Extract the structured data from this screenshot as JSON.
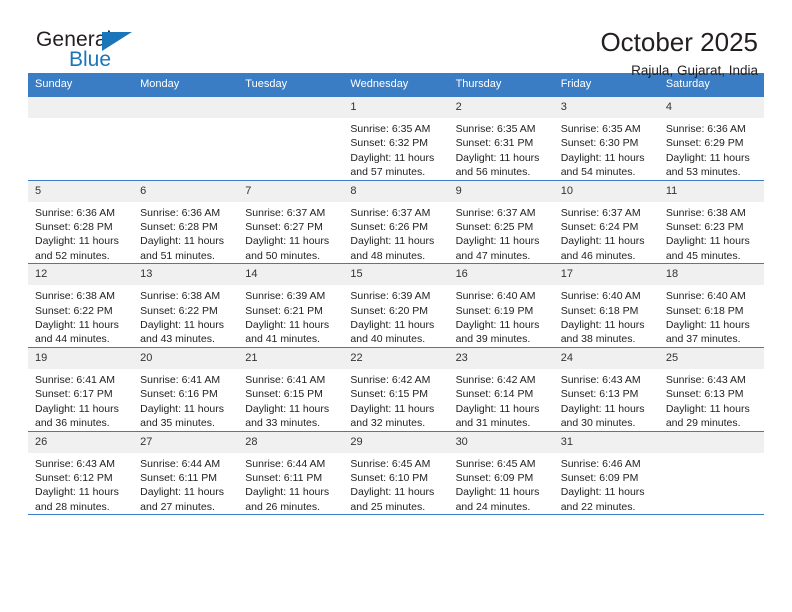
{
  "brand": {
    "word_general": "General",
    "word_blue": "Blue",
    "triangle_color": "#1b75bb"
  },
  "header": {
    "title": "October 2025",
    "location": "Rajula, Gujarat, India"
  },
  "theme": {
    "header_blue": "#3b7dc4",
    "daynum_bg": "#f0f0f0",
    "text": "#222222"
  },
  "calendar": {
    "day_headers": [
      "Sunday",
      "Monday",
      "Tuesday",
      "Wednesday",
      "Thursday",
      "Friday",
      "Saturday"
    ],
    "weeks": [
      [
        {
          "day": "",
          "sunrise": "",
          "sunset": "",
          "daylight": ""
        },
        {
          "day": "",
          "sunrise": "",
          "sunset": "",
          "daylight": ""
        },
        {
          "day": "",
          "sunrise": "",
          "sunset": "",
          "daylight": ""
        },
        {
          "day": "1",
          "sunrise": "Sunrise: 6:35 AM",
          "sunset": "Sunset: 6:32 PM",
          "daylight": "Daylight: 11 hours and 57 minutes."
        },
        {
          "day": "2",
          "sunrise": "Sunrise: 6:35 AM",
          "sunset": "Sunset: 6:31 PM",
          "daylight": "Daylight: 11 hours and 56 minutes."
        },
        {
          "day": "3",
          "sunrise": "Sunrise: 6:35 AM",
          "sunset": "Sunset: 6:30 PM",
          "daylight": "Daylight: 11 hours and 54 minutes."
        },
        {
          "day": "4",
          "sunrise": "Sunrise: 6:36 AM",
          "sunset": "Sunset: 6:29 PM",
          "daylight": "Daylight: 11 hours and 53 minutes."
        }
      ],
      [
        {
          "day": "5",
          "sunrise": "Sunrise: 6:36 AM",
          "sunset": "Sunset: 6:28 PM",
          "daylight": "Daylight: 11 hours and 52 minutes."
        },
        {
          "day": "6",
          "sunrise": "Sunrise: 6:36 AM",
          "sunset": "Sunset: 6:28 PM",
          "daylight": "Daylight: 11 hours and 51 minutes."
        },
        {
          "day": "7",
          "sunrise": "Sunrise: 6:37 AM",
          "sunset": "Sunset: 6:27 PM",
          "daylight": "Daylight: 11 hours and 50 minutes."
        },
        {
          "day": "8",
          "sunrise": "Sunrise: 6:37 AM",
          "sunset": "Sunset: 6:26 PM",
          "daylight": "Daylight: 11 hours and 48 minutes."
        },
        {
          "day": "9",
          "sunrise": "Sunrise: 6:37 AM",
          "sunset": "Sunset: 6:25 PM",
          "daylight": "Daylight: 11 hours and 47 minutes."
        },
        {
          "day": "10",
          "sunrise": "Sunrise: 6:37 AM",
          "sunset": "Sunset: 6:24 PM",
          "daylight": "Daylight: 11 hours and 46 minutes."
        },
        {
          "day": "11",
          "sunrise": "Sunrise: 6:38 AM",
          "sunset": "Sunset: 6:23 PM",
          "daylight": "Daylight: 11 hours and 45 minutes."
        }
      ],
      [
        {
          "day": "12",
          "sunrise": "Sunrise: 6:38 AM",
          "sunset": "Sunset: 6:22 PM",
          "daylight": "Daylight: 11 hours and 44 minutes."
        },
        {
          "day": "13",
          "sunrise": "Sunrise: 6:38 AM",
          "sunset": "Sunset: 6:22 PM",
          "daylight": "Daylight: 11 hours and 43 minutes."
        },
        {
          "day": "14",
          "sunrise": "Sunrise: 6:39 AM",
          "sunset": "Sunset: 6:21 PM",
          "daylight": "Daylight: 11 hours and 41 minutes."
        },
        {
          "day": "15",
          "sunrise": "Sunrise: 6:39 AM",
          "sunset": "Sunset: 6:20 PM",
          "daylight": "Daylight: 11 hours and 40 minutes."
        },
        {
          "day": "16",
          "sunrise": "Sunrise: 6:40 AM",
          "sunset": "Sunset: 6:19 PM",
          "daylight": "Daylight: 11 hours and 39 minutes."
        },
        {
          "day": "17",
          "sunrise": "Sunrise: 6:40 AM",
          "sunset": "Sunset: 6:18 PM",
          "daylight": "Daylight: 11 hours and 38 minutes."
        },
        {
          "day": "18",
          "sunrise": "Sunrise: 6:40 AM",
          "sunset": "Sunset: 6:18 PM",
          "daylight": "Daylight: 11 hours and 37 minutes."
        }
      ],
      [
        {
          "day": "19",
          "sunrise": "Sunrise: 6:41 AM",
          "sunset": "Sunset: 6:17 PM",
          "daylight": "Daylight: 11 hours and 36 minutes."
        },
        {
          "day": "20",
          "sunrise": "Sunrise: 6:41 AM",
          "sunset": "Sunset: 6:16 PM",
          "daylight": "Daylight: 11 hours and 35 minutes."
        },
        {
          "day": "21",
          "sunrise": "Sunrise: 6:41 AM",
          "sunset": "Sunset: 6:15 PM",
          "daylight": "Daylight: 11 hours and 33 minutes."
        },
        {
          "day": "22",
          "sunrise": "Sunrise: 6:42 AM",
          "sunset": "Sunset: 6:15 PM",
          "daylight": "Daylight: 11 hours and 32 minutes."
        },
        {
          "day": "23",
          "sunrise": "Sunrise: 6:42 AM",
          "sunset": "Sunset: 6:14 PM",
          "daylight": "Daylight: 11 hours and 31 minutes."
        },
        {
          "day": "24",
          "sunrise": "Sunrise: 6:43 AM",
          "sunset": "Sunset: 6:13 PM",
          "daylight": "Daylight: 11 hours and 30 minutes."
        },
        {
          "day": "25",
          "sunrise": "Sunrise: 6:43 AM",
          "sunset": "Sunset: 6:13 PM",
          "daylight": "Daylight: 11 hours and 29 minutes."
        }
      ],
      [
        {
          "day": "26",
          "sunrise": "Sunrise: 6:43 AM",
          "sunset": "Sunset: 6:12 PM",
          "daylight": "Daylight: 11 hours and 28 minutes."
        },
        {
          "day": "27",
          "sunrise": "Sunrise: 6:44 AM",
          "sunset": "Sunset: 6:11 PM",
          "daylight": "Daylight: 11 hours and 27 minutes."
        },
        {
          "day": "28",
          "sunrise": "Sunrise: 6:44 AM",
          "sunset": "Sunset: 6:11 PM",
          "daylight": "Daylight: 11 hours and 26 minutes."
        },
        {
          "day": "29",
          "sunrise": "Sunrise: 6:45 AM",
          "sunset": "Sunset: 6:10 PM",
          "daylight": "Daylight: 11 hours and 25 minutes."
        },
        {
          "day": "30",
          "sunrise": "Sunrise: 6:45 AM",
          "sunset": "Sunset: 6:09 PM",
          "daylight": "Daylight: 11 hours and 24 minutes."
        },
        {
          "day": "31",
          "sunrise": "Sunrise: 6:46 AM",
          "sunset": "Sunset: 6:09 PM",
          "daylight": "Daylight: 11 hours and 22 minutes."
        },
        {
          "day": "",
          "sunrise": "",
          "sunset": "",
          "daylight": ""
        }
      ]
    ]
  }
}
